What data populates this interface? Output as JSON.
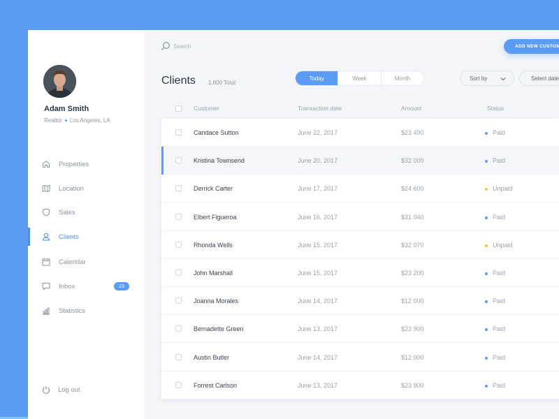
{
  "user": {
    "name": "Adam Smith",
    "role": "Realtor",
    "location": "Los Angeles, LA"
  },
  "nav": [
    {
      "label": "Properties",
      "icon": "home-icon"
    },
    {
      "label": "Location",
      "icon": "map-icon"
    },
    {
      "label": "Sales",
      "icon": "shield-icon"
    },
    {
      "label": "Clients",
      "icon": "user-icon",
      "active": true
    },
    {
      "label": "Calendar",
      "icon": "calendar-icon"
    },
    {
      "label": "Inbox",
      "icon": "message-icon",
      "badge": "23"
    },
    {
      "label": "Statistics",
      "icon": "bar-chart-icon"
    }
  ],
  "logout": {
    "label": "Log out",
    "icon": "power-icon"
  },
  "search": {
    "placeholder": "Search"
  },
  "add_button": "ADD NEW CUSTOMER",
  "page": {
    "title": "Clients",
    "total": "1,800 Total"
  },
  "period_tabs": [
    {
      "label": "Today",
      "active": true
    },
    {
      "label": "Week"
    },
    {
      "label": "Month"
    }
  ],
  "sort": {
    "label": "Sort by"
  },
  "date_select": {
    "label": "Select date"
  },
  "table": {
    "headers": [
      "Customer",
      "Transaction date",
      "Amount",
      "Status"
    ],
    "rows": [
      {
        "customer": "Candace Sutton",
        "date": "June 22, 2017",
        "amount": "$23 490",
        "status": "Paid"
      },
      {
        "customer": "Kristina Townsend",
        "date": "June 20, 2017",
        "amount": "$32 000",
        "status": "Paid",
        "selected": true
      },
      {
        "customer": "Derrick Carter",
        "date": "June 17, 2017",
        "amount": "$24 600",
        "status": "Unpaid"
      },
      {
        "customer": "Elbert Figueroa",
        "date": "June 16, 2017",
        "amount": "$31 040",
        "status": "Paid"
      },
      {
        "customer": "Rhonda Wells",
        "date": "June 15, 2017",
        "amount": "$32 070",
        "status": "Unpaid"
      },
      {
        "customer": "John Marshall",
        "date": "June 15, 2017",
        "amount": "$23 200",
        "status": "Paid"
      },
      {
        "customer": "Joanna Morales",
        "date": "June 14, 2017",
        "amount": "$12 000",
        "status": "Paid"
      },
      {
        "customer": "Bernadette Green",
        "date": "June 13, 2017",
        "amount": "$23 900",
        "status": "Paid"
      },
      {
        "customer": "Austin Butler",
        "date": "June 14, 2017",
        "amount": "$12 000",
        "status": "Paid"
      },
      {
        "customer": "Forrest Carlson",
        "date": "June 13, 2017",
        "amount": "$23 900",
        "status": "Paid"
      }
    ]
  },
  "colors": {
    "accent": "#5a9cf3",
    "paid": "#5a9cf3",
    "unpaid": "#f5c33b"
  }
}
